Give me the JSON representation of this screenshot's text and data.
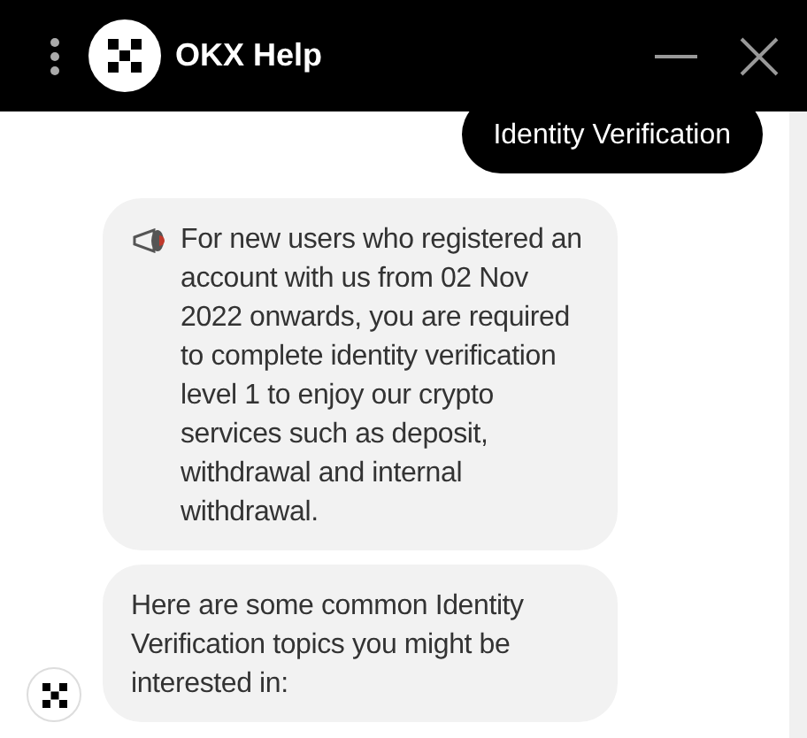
{
  "window": {
    "title": "OKX Help"
  },
  "messages": [
    {
      "kind": "user",
      "text": "Identity Verification"
    },
    {
      "kind": "notice",
      "text": "For new users who registered an account with us from 02 Nov 2022 onwards, you are required to complete identity verification level 1 to enjoy our crypto services such as deposit, withdrawal and internal withdrawal."
    },
    {
      "kind": "bot",
      "text": "Here are some common Identity Verification topics you might be interested in:"
    }
  ]
}
